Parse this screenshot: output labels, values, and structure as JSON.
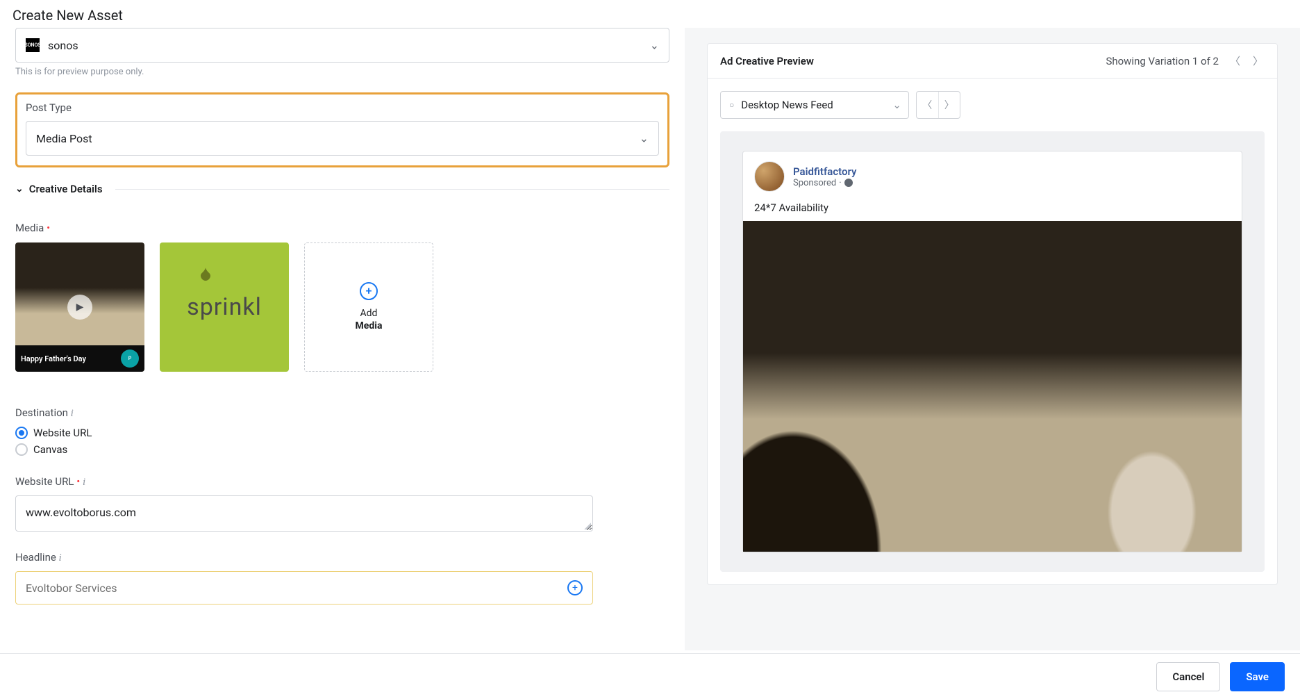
{
  "header": {
    "title": "Create New Asset"
  },
  "account": {
    "label": "sonos",
    "helper": "This is for preview purpose only."
  },
  "postType": {
    "label": "Post Type",
    "value": "Media Post"
  },
  "creativeDetails": {
    "title": "Creative Details"
  },
  "media": {
    "label": "Media",
    "thumb1_caption": "Happy Father's Day",
    "thumb2_text": "sprinkl",
    "add_line1": "Add",
    "add_line2": "Media"
  },
  "destination": {
    "label": "Destination",
    "option_website": "Website URL",
    "option_canvas": "Canvas"
  },
  "websiteUrl": {
    "label": "Website URL",
    "value": "www.evoltoborus.com"
  },
  "headline": {
    "label": "Headline",
    "value": "Evoltobor Services"
  },
  "preview": {
    "title": "Ad Creative Preview",
    "variation_text": "Showing Variation 1 of 2",
    "placement": "Desktop News Feed",
    "page_name": "Paidfitfactory",
    "sponsored": "Sponsored",
    "primary_text": "24*7 Availability"
  },
  "footer": {
    "cancel": "Cancel",
    "save": "Save"
  }
}
